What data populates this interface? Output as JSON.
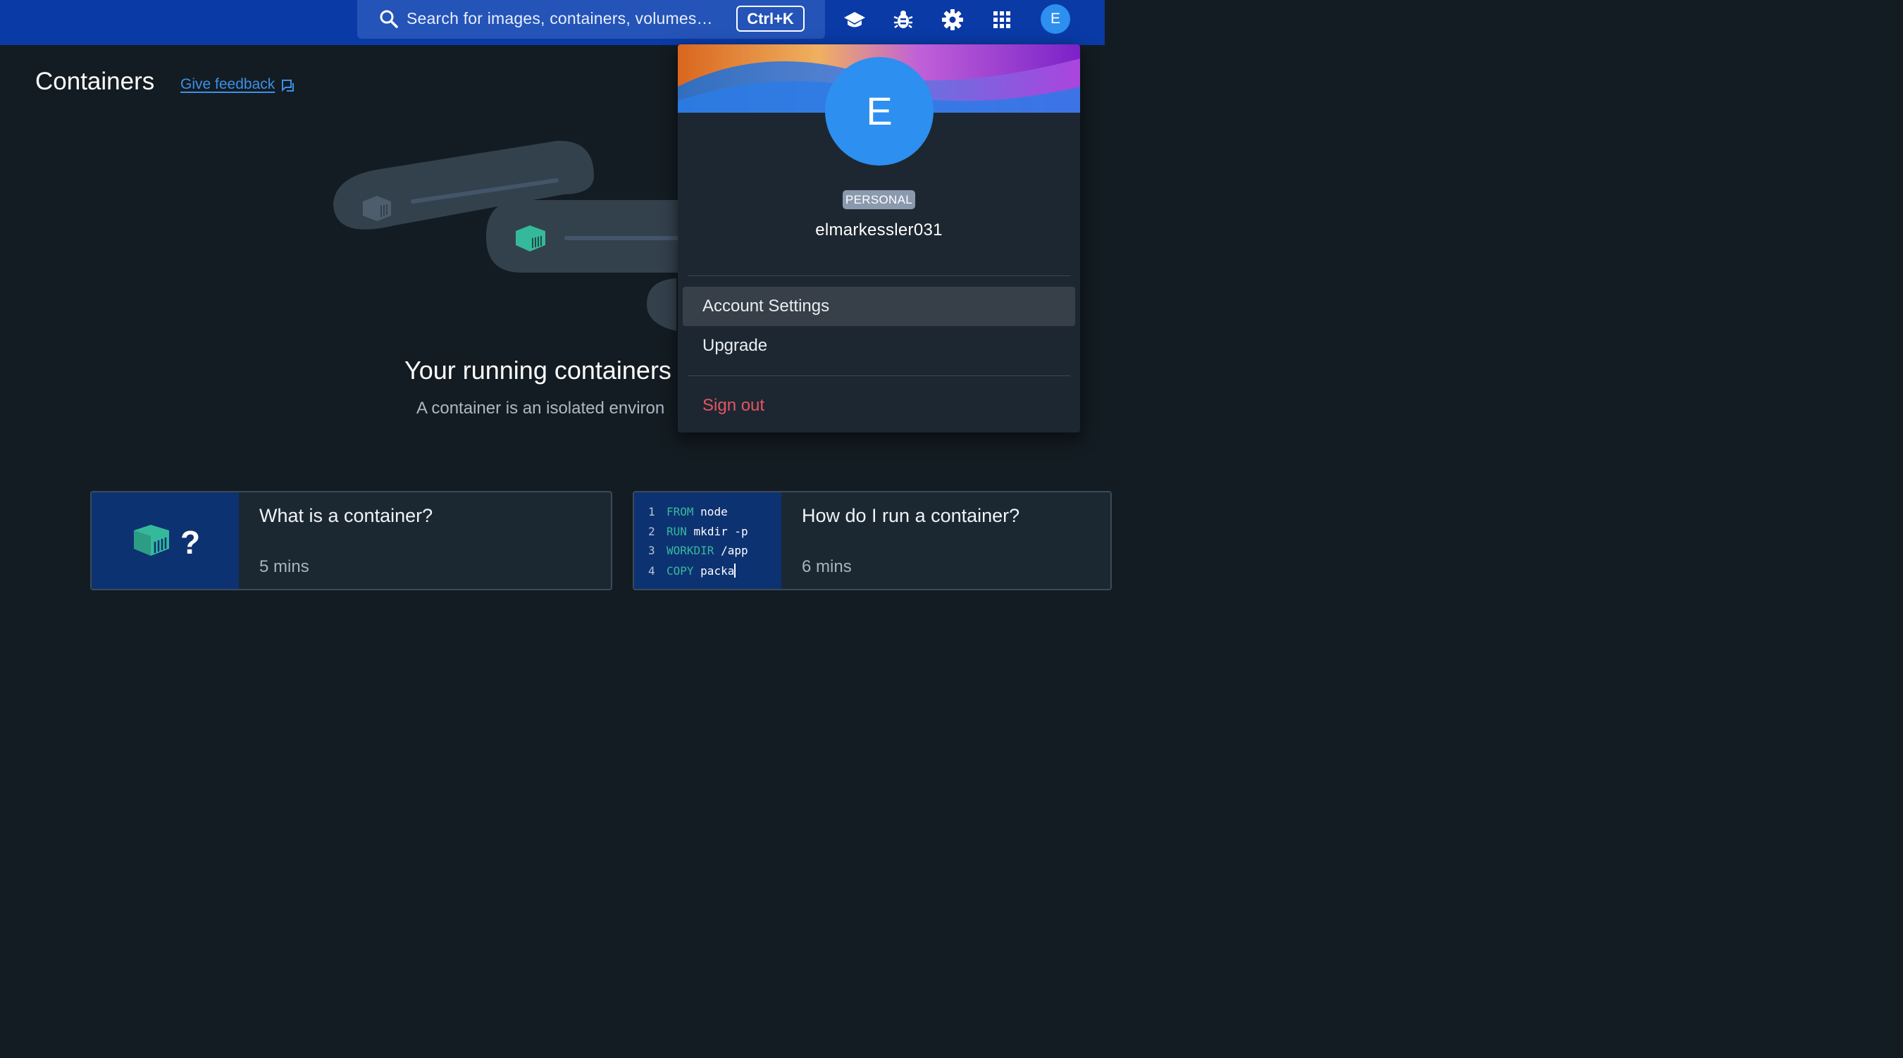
{
  "topbar": {
    "search_placeholder": "Search for images, containers, volumes…",
    "search_shortcut": "Ctrl+K",
    "icons": [
      "learn-icon",
      "bug-icon",
      "settings-icon",
      "apps-grid-icon"
    ],
    "avatar_initial": "E"
  },
  "page": {
    "title": "Containers",
    "feedback_link": "Give feedback"
  },
  "empty_state": {
    "title": "Your running containers",
    "description": "A container is an isolated environ"
  },
  "cards": [
    {
      "title": "What is a container?",
      "duration": "5 mins"
    },
    {
      "title": "How do I run a container?",
      "duration": "6 mins",
      "code": [
        {
          "n": "1",
          "kw": "FROM",
          "arg": "node"
        },
        {
          "n": "2",
          "kw": "RUN",
          "arg": "mkdir -p"
        },
        {
          "n": "3",
          "kw": "WORKDIR",
          "arg": "/app"
        },
        {
          "n": "4",
          "kw": "COPY",
          "arg": "packa"
        }
      ]
    }
  ],
  "account_menu": {
    "avatar_initial": "E",
    "plan_badge": "PERSONAL",
    "username": "elmarkessler031",
    "items": [
      "Account Settings",
      "Upgrade"
    ],
    "sign_out": "Sign out"
  },
  "colors": {
    "topbar": "#0a3aa6",
    "background": "#131c22",
    "accent": "#2d8ff0",
    "container_teal": "#35b99b",
    "danger": "#e55562"
  }
}
